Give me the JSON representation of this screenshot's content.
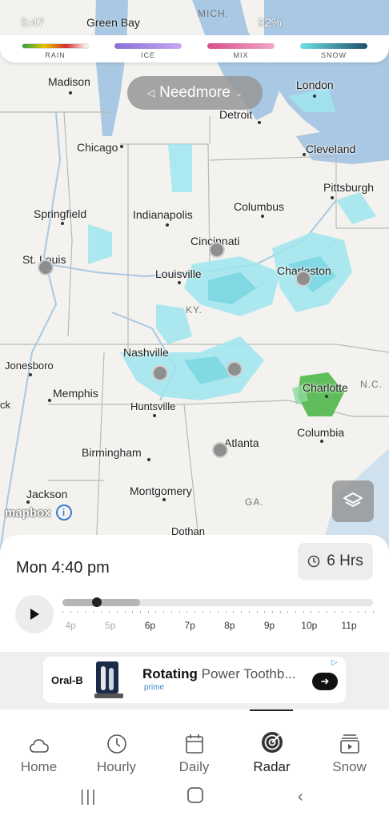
{
  "status_bar": {
    "time": "5:47",
    "status_right": "92%"
  },
  "legend": {
    "items": [
      {
        "label": "RAIN",
        "colors": [
          "#2ea043",
          "#e6c200",
          "#d13030"
        ]
      },
      {
        "label": "ICE",
        "colors": [
          "#8b6fd6",
          "#c6a8f2"
        ]
      },
      {
        "label": "MIX",
        "colors": [
          "#d64f8a",
          "#f2a7c8"
        ]
      },
      {
        "label": "SNOW",
        "colors": [
          "#6fe0e6",
          "#1d4f6b"
        ]
      }
    ]
  },
  "location": {
    "label": "Needmore"
  },
  "map": {
    "cities": [
      "Green Bay",
      "Madison",
      "London",
      "Detroit",
      "Chicago",
      "Cleveland",
      "Pittsburgh",
      "Springfield",
      "Indianapolis",
      "Columbus",
      "Cincinnati",
      "St. Louis",
      "Louisville",
      "Charleston",
      "Nashville",
      "Jonesboro",
      "Memphis",
      "Huntsville",
      "Charlotte",
      "Columbia",
      "Atlanta",
      "Birmingham",
      "Jackson",
      "Montgomery",
      "Dothan",
      "ck"
    ],
    "states": [
      "MICH.",
      "KY.",
      "N.C.",
      "GA."
    ],
    "attribution": "mapbox"
  },
  "timeline": {
    "timestamp": "Mon 4:40 pm",
    "range_label": "6 Hrs",
    "hour_labels": [
      "4p",
      "5p",
      "6p",
      "7p",
      "8p",
      "9p",
      "10p",
      "11p"
    ],
    "played_fraction": 0.25,
    "current_fraction": 0.11
  },
  "ad": {
    "brand": "Oral-B",
    "title_bold": "Rotating",
    "title_rest": "Power Toothb...",
    "badge": "prime"
  },
  "nav": {
    "items": [
      {
        "label": "Home",
        "icon": "cloud-icon"
      },
      {
        "label": "Hourly",
        "icon": "clock-icon"
      },
      {
        "label": "Daily",
        "icon": "calendar-icon"
      },
      {
        "label": "Radar",
        "icon": "radar-icon",
        "active": true
      },
      {
        "label": "Snow",
        "icon": "snow-video-icon"
      }
    ]
  },
  "colors": {
    "snow_light": "#9fe6ee",
    "snow_mid": "#6fd3df",
    "rain_green": "#4fb84a",
    "water": "#a9c8e3"
  }
}
